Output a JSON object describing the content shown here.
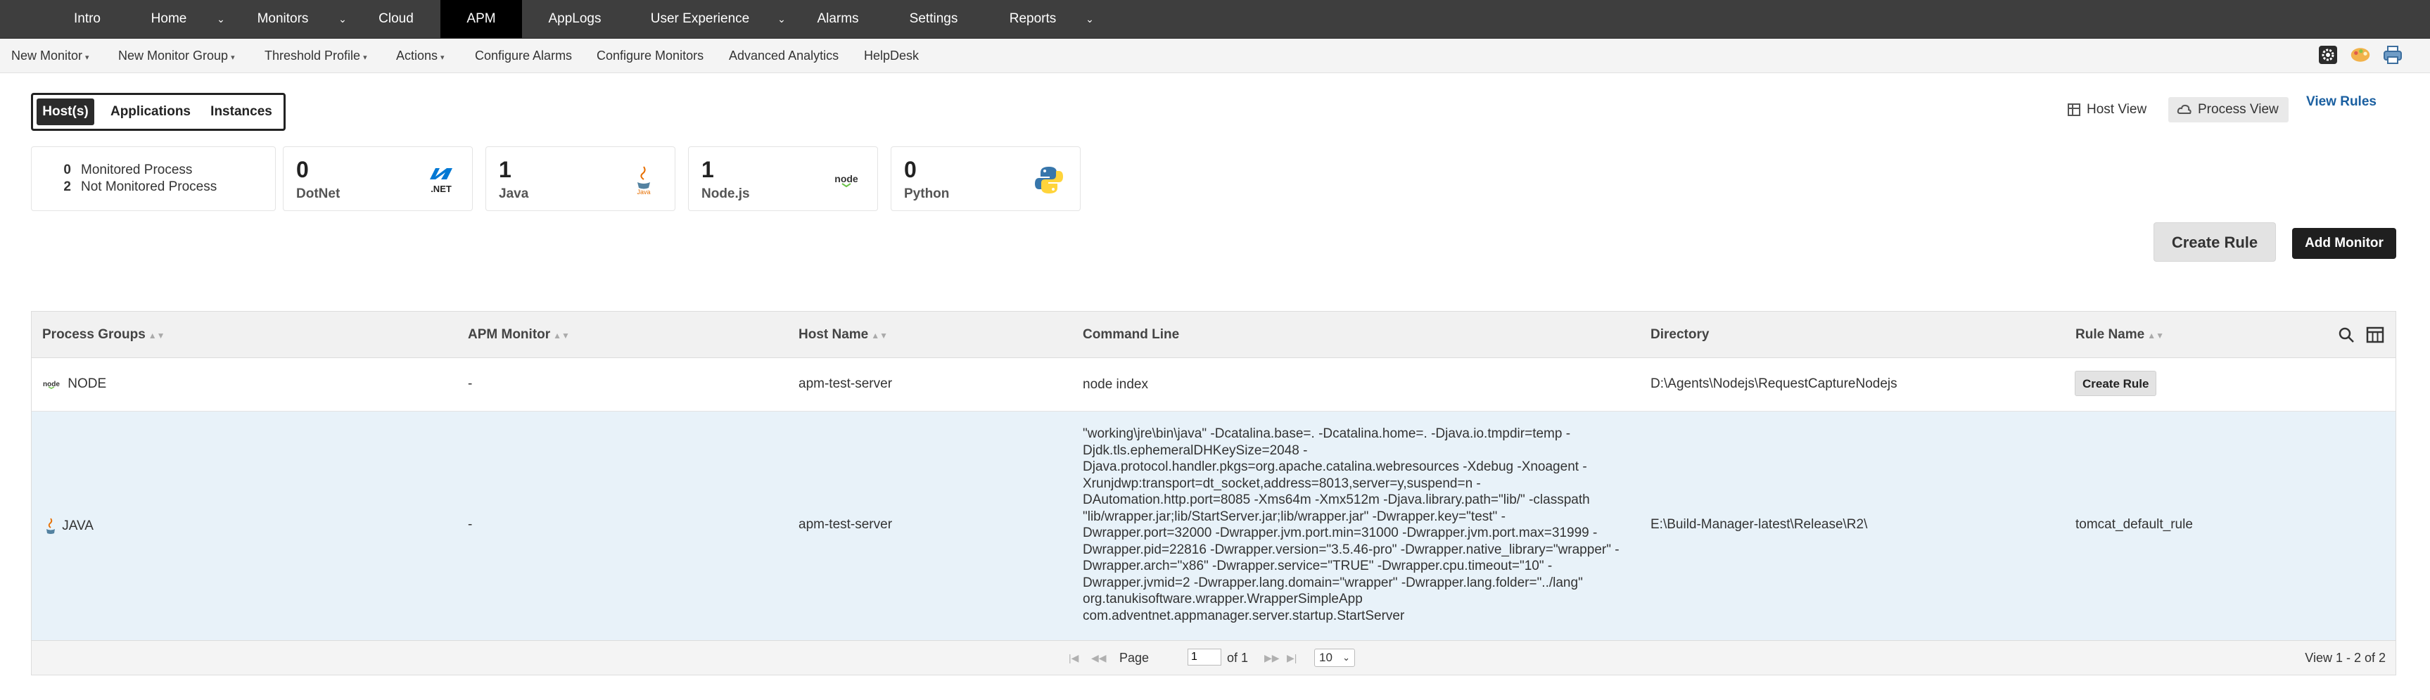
{
  "top_nav": {
    "items": [
      {
        "label": "Intro"
      },
      {
        "label": "Home"
      },
      {
        "label": "Monitors"
      },
      {
        "label": "Cloud"
      },
      {
        "label": "APM"
      },
      {
        "label": "AppLogs"
      },
      {
        "label": "User Experience"
      },
      {
        "label": "Alarms"
      },
      {
        "label": "Settings"
      },
      {
        "label": "Reports"
      }
    ],
    "active": "APM"
  },
  "sub_nav": {
    "items": [
      {
        "label": "New Monitor"
      },
      {
        "label": "New Monitor Group"
      },
      {
        "label": "Threshold Profile"
      },
      {
        "label": "Actions"
      },
      {
        "label": "Configure Alarms"
      },
      {
        "label": "Configure Monitors"
      },
      {
        "label": "Advanced Analytics"
      },
      {
        "label": "HelpDesk"
      }
    ],
    "right_icons": [
      "settings-gear-icon",
      "theme-palette-icon",
      "printer-icon"
    ]
  },
  "view_toggle": {
    "options": [
      {
        "label": "Host(s)"
      },
      {
        "label": "Applications"
      },
      {
        "label": "Instances"
      }
    ],
    "selected": "Host(s)"
  },
  "view_links": {
    "host_view": "Host View",
    "process_view": "Process View",
    "view_rules": "View Rules",
    "selected": "Process View"
  },
  "summary": {
    "monitored": {
      "count": "0",
      "label": "Monitored Process"
    },
    "not_monitored": {
      "count": "2",
      "label": "Not Monitored Process"
    }
  },
  "tech_cards": [
    {
      "count": "0",
      "label": "DotNet",
      "icon": "dotnet-icon",
      "icon_text": ".NET",
      "color": "#0078d4"
    },
    {
      "count": "1",
      "label": "Java",
      "icon": "java-icon",
      "icon_text": "Java",
      "color": "#e76f00"
    },
    {
      "count": "1",
      "label": "Node.js",
      "icon": "nodejs-icon",
      "icon_text": "node",
      "color": "#333333"
    },
    {
      "count": "0",
      "label": "Python",
      "icon": "python-icon",
      "icon_text": "",
      "color": "#3776ab"
    }
  ],
  "actions": {
    "create_rule": "Create Rule",
    "add_monitor": "Add Monitor"
  },
  "table": {
    "columns": [
      "Process Groups",
      "APM Monitor",
      "Host Name",
      "Command Line",
      "Directory",
      "Rule Name"
    ],
    "rows": [
      {
        "group": "NODE",
        "group_icon": "nodejs-icon",
        "apm_monitor": "-",
        "host": "apm-test-server",
        "command_lines": [
          "node index"
        ],
        "directory": "D:\\Agents\\Nodejs\\RequestCaptureNodejs",
        "rule": "Create Rule"
      },
      {
        "group": "JAVA",
        "group_icon": "java-icon",
        "apm_monitor": "-",
        "host": "apm-test-server",
        "command_lines": [
          "\"working\\jre\\bin\\java\" -Dcatalina.base=. -Dcatalina.home=. -Djava.io.tmpdir=temp -",
          "Djdk.tls.ephemeralDHKeySize=2048 -",
          "Djava.protocol.handler.pkgs=org.apache.catalina.webresources -Xdebug -Xnoagent -",
          "Xrunjdwp:transport=dt_socket,address=8013,server=y,suspend=n -",
          "DAutomation.http.port=8085 -Xms64m -Xmx512m -Djava.library.path=\"lib/\" -classpath",
          "\"lib/wrapper.jar;lib/StartServer.jar;lib/wrapper.jar\" -Dwrapper.key=\"test\" -",
          "Dwrapper.port=32000 -Dwrapper.jvm.port.min=31000 -Dwrapper.jvm.port.max=31999 -",
          "Dwrapper.pid=22816 -Dwrapper.version=\"3.5.46-pro\" -Dwrapper.native_library=\"wrapper\" -",
          "Dwrapper.arch=\"x86\" -Dwrapper.service=\"TRUE\" -Dwrapper.cpu.timeout=\"10\" -",
          "Dwrapper.jvmid=2 -Dwrapper.lang.domain=\"wrapper\" -Dwrapper.lang.folder=\"../lang\"",
          "org.tanukisoftware.wrapper.WrapperSimpleApp",
          "com.adventnet.appmanager.server.startup.StartServer"
        ],
        "directory": "E:\\Build-Manager-latest\\Release\\R2\\",
        "rule": "tomcat_default_rule"
      }
    ]
  },
  "pager": {
    "page_label": "Page",
    "page_value": "1",
    "of_label": "of 1",
    "page_size": "10",
    "view_summary": "View 1 - 2 of 2"
  }
}
